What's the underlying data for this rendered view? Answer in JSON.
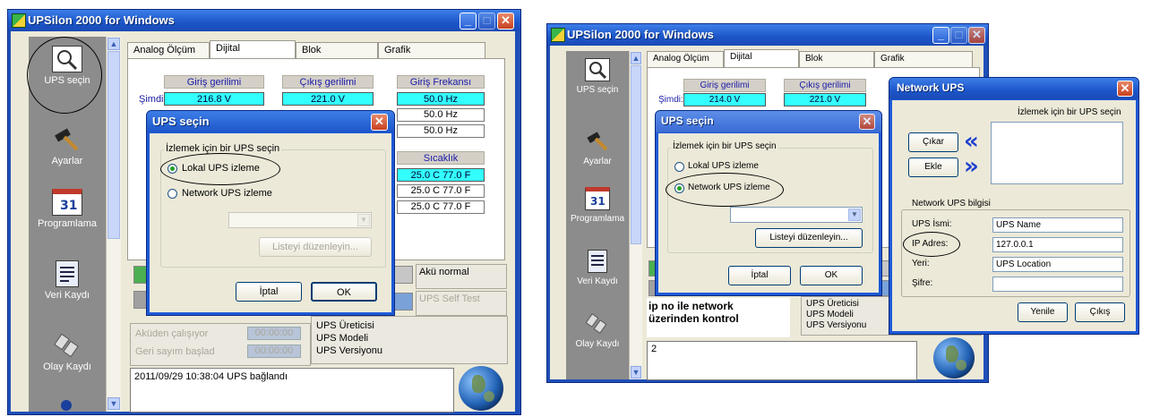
{
  "left_app": {
    "title": "UPSilon 2000 for Windows",
    "sidebar": [
      {
        "label": "UPS seçin",
        "icon": "magnifier-icon"
      },
      {
        "label": "Ayarlar",
        "icon": "hammer-icon"
      },
      {
        "label": "Programlama",
        "icon": "calendar-icon"
      },
      {
        "label": "Veri Kaydı",
        "icon": "document-icon"
      },
      {
        "label": "Olay Kaydı",
        "icon": "satellite-icon"
      }
    ],
    "tabs": [
      "Analog Ölçüm",
      "Dijital",
      "Blok",
      "Grafik"
    ],
    "headers": {
      "input_voltage": "Giriş gerilimi",
      "output_voltage": "Çıkış gerilimi",
      "input_freq": "Giriş Frekansı",
      "temperature": "Sıcaklık"
    },
    "now_label": "Şimdi:",
    "input_voltage": "216.8 V",
    "output_voltage": "221.0 V",
    "freq": [
      "50.0 Hz",
      "50.0 Hz",
      "50.0 Hz"
    ],
    "temps": [
      "25.0 C  77.0 F",
      "25.0 C  77.0 F",
      "25.0 C  77.0 F"
    ],
    "battery_status": "Akü normal",
    "self_test": "UPS Self Test",
    "on_battery_label": "Aküden çalışıyor",
    "countdown_label": "Geri sayım başlad",
    "on_battery_time": "00:00:00",
    "countdown_time": "00:00:00",
    "ups_info": [
      "UPS Üreticisi",
      "UPS Modeli",
      "UPS Versiyonu"
    ],
    "log": "2011/09/29 10:38:04  UPS bağlandı",
    "dialog": {
      "title": "UPS seçin",
      "group_label": "İzlemek için bir UPS seçin",
      "option_local": "Lokal UPS izleme",
      "option_network": "Network UPS izleme",
      "edit_list": "Listeyi düzenleyin...",
      "cancel": "İptal",
      "ok": "OK"
    }
  },
  "right_app": {
    "title": "UPSilon 2000 for Windows",
    "sidebar": [
      {
        "label": "UPS seçin",
        "icon": "magnifier-icon"
      },
      {
        "label": "Ayarlar",
        "icon": "hammer-icon"
      },
      {
        "label": "Programlama",
        "icon": "calendar-icon"
      },
      {
        "label": "Veri Kaydı",
        "icon": "document-icon"
      },
      {
        "label": "Olay Kaydı",
        "icon": "satellite-icon"
      }
    ],
    "tabs": [
      "Analog Ölçüm",
      "Dijital",
      "Blok",
      "Grafik"
    ],
    "headers": {
      "input_voltage": "Giriş gerilimi",
      "output_voltage": "Çıkış gerilimi"
    },
    "now_label": "Şimdi:",
    "input_voltage": "214.0 V",
    "output_voltage": "221.0 V",
    "annotation": "ip no ile network\nüzerinden kontrol",
    "ups_info": [
      "UPS Üreticisi",
      "UPS Modeli",
      "UPS Versiyonu"
    ],
    "log_fragment": "2",
    "dialog": {
      "title": "UPS seçin",
      "group_label": "İzlemek için bir UPS seçin",
      "option_local": "Lokal UPS izleme",
      "option_network": "Network UPS izleme",
      "edit_list": "Listeyi düzenleyin...",
      "cancel": "İptal",
      "ok": "OK"
    },
    "network_dialog": {
      "title": "Network UPS",
      "list_label": "İzlemek için bir UPS seçin",
      "remove": "Çıkar",
      "add": "Ekle",
      "info_label": "Network UPS bilgisi",
      "name_label": "UPS İsmi:",
      "ip_label": "IP Adres:",
      "location_label": "Yeri:",
      "password_label": "Şifre:",
      "name_value": "UPS Name",
      "ip_value": "127.0.0.1",
      "location_value": "UPS Location",
      "password_value": "",
      "refresh": "Yenile",
      "exit": "Çıkış"
    }
  }
}
